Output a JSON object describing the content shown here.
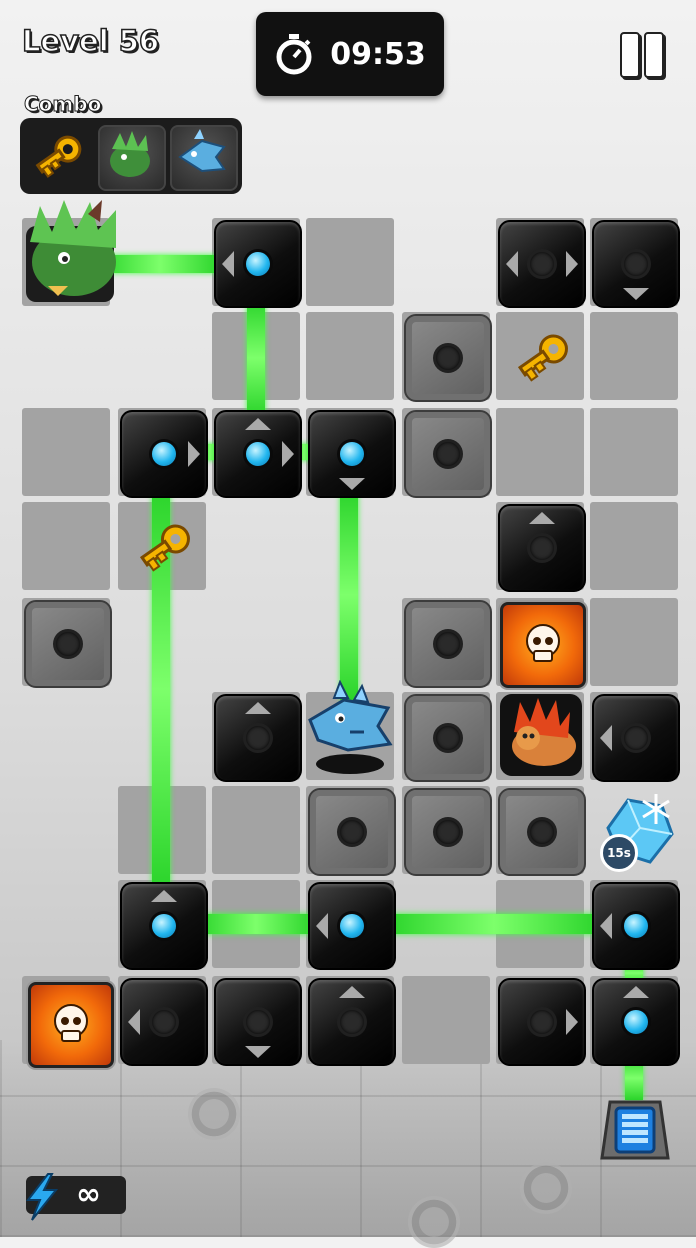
{
  "hud": {
    "level_label": "Level 56",
    "timer": "09:53",
    "combo_label": "Combo",
    "combo_items": [
      "key-icon",
      "green-dragon-icon",
      "blue-fish-monster-icon"
    ],
    "energy_value": "∞"
  },
  "board": {
    "special_items": {
      "freeze_powerup_label": "15s"
    }
  },
  "colors": {
    "beam": "#35e035",
    "orb": "#21b6ef",
    "lava": "#f26a0a",
    "timer_bg": "#111111"
  }
}
